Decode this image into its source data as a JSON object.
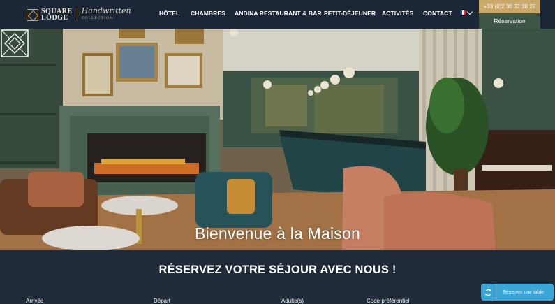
{
  "header": {
    "logo": {
      "line1": "SQUARE",
      "line2": "LODGE",
      "script": "Handwritten",
      "script_sub": "COLLECTION"
    },
    "nav": [
      {
        "label": "HÔTEL"
      },
      {
        "label": "CHAMBRES"
      },
      {
        "label": "ANDINA RESTAURANT & BAR"
      },
      {
        "label": "PETIT-DÉJEUNER"
      },
      {
        "label": "ACTIVITÉS"
      },
      {
        "label": "CONTACT"
      }
    ],
    "language": {
      "flag_colors": [
        "#1f3f99",
        "#ffffff",
        "#d8283a"
      ],
      "icon": "chevron-down-icon"
    },
    "phone": "+33 (0)2 30 32 38 26",
    "reservation": "Réservation"
  },
  "hero": {
    "title": "Bienvenue à la Maison",
    "emblem_icon": "house-emblem-icon"
  },
  "booking": {
    "title": "RÉSERVEZ VOTRE SÉJOUR AVEC NOUS !",
    "fields": [
      {
        "label": "Arrivée"
      },
      {
        "label": "Départ"
      },
      {
        "label": "Adulte(s)"
      },
      {
        "label": "Code préférentiel"
      }
    ]
  },
  "table_button": {
    "label": "Réserver une table",
    "icon": "table-booking-icon"
  },
  "colors": {
    "header_bg": "#1b2736",
    "gold": "#c9a86a",
    "green": "#3e5646",
    "booking_bg": "#1f2b39",
    "table_button": "#3aa6d8"
  }
}
